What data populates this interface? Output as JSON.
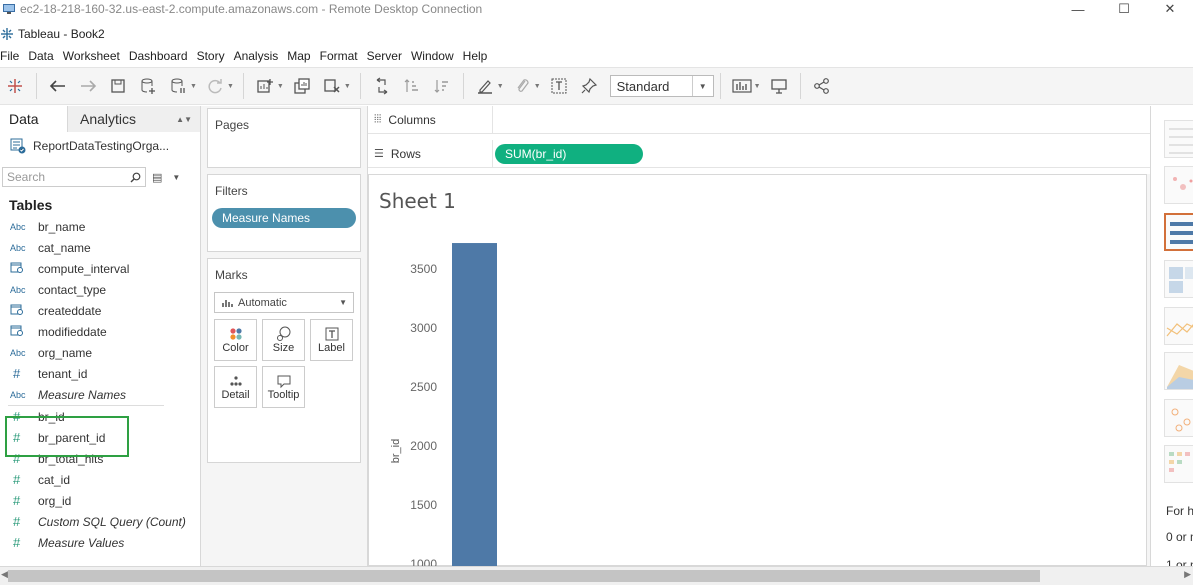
{
  "rdp": {
    "title": "ec2-18-218-160-32.us-east-2.compute.amazonaws.com - Remote Desktop Connection"
  },
  "app": {
    "title": "Tableau - Book2"
  },
  "menu": [
    "File",
    "Data",
    "Worksheet",
    "Dashboard",
    "Story",
    "Analysis",
    "Map",
    "Format",
    "Server",
    "Window",
    "Help"
  ],
  "toolbar": {
    "fit_select": "Standard"
  },
  "data_pane": {
    "tabs": {
      "data": "Data",
      "analytics": "Analytics"
    },
    "datasource": "ReportDataTestingOrga...",
    "search_placeholder": "Search",
    "tables_header": "Tables",
    "dimensions": [
      {
        "type": "Abc",
        "name": "br_name"
      },
      {
        "type": "Abc",
        "name": "cat_name"
      },
      {
        "type": "cal",
        "name": "compute_interval"
      },
      {
        "type": "Abc",
        "name": "contact_type"
      },
      {
        "type": "cal",
        "name": "createddate"
      },
      {
        "type": "cal",
        "name": "modifieddate"
      },
      {
        "type": "Abc",
        "name": "org_name"
      },
      {
        "type": "#",
        "name": "tenant_id"
      },
      {
        "type": "Abc",
        "name": "Measure Names",
        "italic": true
      }
    ],
    "measures": [
      {
        "type": "#",
        "name": "br_id"
      },
      {
        "type": "#",
        "name": "br_parent_id"
      },
      {
        "type": "#",
        "name": "br_total_hits"
      },
      {
        "type": "#",
        "name": "cat_id"
      },
      {
        "type": "#",
        "name": "org_id"
      },
      {
        "type": "#",
        "name": "Custom SQL Query (Count)",
        "italic": true
      },
      {
        "type": "#",
        "name": "Measure Values",
        "italic": true
      }
    ]
  },
  "shelves": {
    "pages": "Pages",
    "filters": "Filters",
    "filter_pill": "Measure Names",
    "marks": "Marks",
    "marks_type": "Automatic",
    "mark_buttons": [
      "Color",
      "Size",
      "Label",
      "Detail",
      "Tooltip"
    ],
    "columns": "Columns",
    "rows": "Rows",
    "rows_pill": "SUM(br_id)"
  },
  "sheet": {
    "title": "Sheet 1"
  },
  "chart_data": {
    "type": "bar",
    "categories": [
      ""
    ],
    "values": [
      3720
    ],
    "ylabel": "br_id",
    "yticks": [
      1000,
      1500,
      2000,
      2500,
      3000,
      3500
    ],
    "ylim": [
      1000,
      3900
    ],
    "color": "#4e79a7"
  },
  "showme": {
    "text1": "For h",
    "text2": "0 or m",
    "text3": "1 or m"
  },
  "colors": {
    "accent_green": "#10b080",
    "filter_pill": "#4c90ad",
    "bar": "#4e79a7",
    "selection": "#2ea043"
  }
}
